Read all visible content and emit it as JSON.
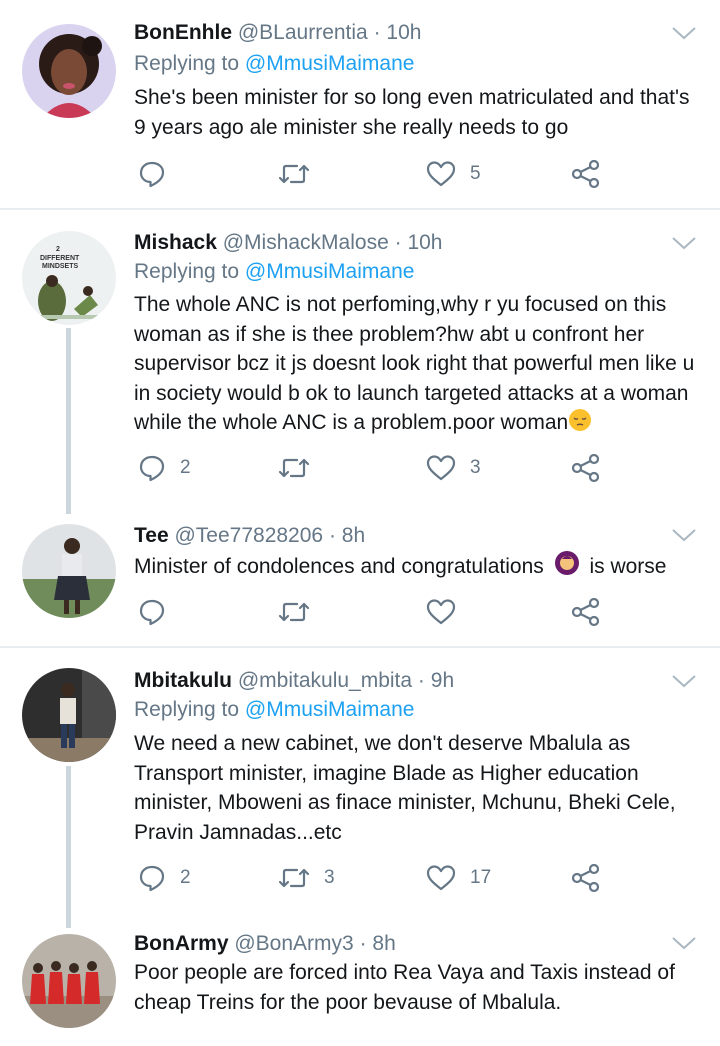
{
  "tweets": [
    {
      "name": "BonEnhle",
      "handle": "@BLaurrentia",
      "time": "10h",
      "replying_prefix": "Replying to",
      "replying_to": "@MmusiMaimane",
      "text": "She's been minister for so long even matriculated and that's 9 years ago ale minister she really needs to go",
      "replies": "",
      "retweets": "",
      "likes": "5"
    },
    {
      "name": "Mishack",
      "handle": "@MishackMalose",
      "time": "10h",
      "replying_prefix": "Replying to",
      "replying_to": "@MmusiMaimane",
      "text": "The whole ANC is not perfoming,why r yu focused on this woman as if she is thee problem?hw abt u confront her supervisor bcz it js doesnt look right that powerful men like u in society would b ok to launch targeted attacks at a woman while the whole ANC is a problem.poor woman",
      "replies": "2",
      "retweets": "",
      "likes": "3",
      "avatar_text_1": "2",
      "avatar_text_2": "DIFFERENT",
      "avatar_text_3": "MINDSETS"
    },
    {
      "name": "Tee",
      "handle": "@Tee77828206",
      "time": "8h",
      "text_before": "Minister of condolences and congratulations",
      "text_after": "is worse",
      "replies": "",
      "retweets": "",
      "likes": ""
    },
    {
      "name": "Mbitakulu",
      "handle": "@mbitakulu_mbita",
      "time": "9h",
      "replying_prefix": "Replying to",
      "replying_to": "@MmusiMaimane",
      "text": "We need a new cabinet, we don't deserve Mbalula as Transport minister, imagine Blade as Higher education minister, Mboweni as finace minister, Mchunu, Bheki Cele, Pravin Jamnadas...etc",
      "replies": "2",
      "retweets": "3",
      "likes": "17"
    },
    {
      "name": "BonArmy",
      "handle": "@BonArmy3",
      "time": "8h",
      "text": "Poor people are forced into Rea Vaya and Taxis instead of cheap Treins for the poor bevause of Mbalula."
    }
  ],
  "separator": "·",
  "icons": {
    "reply": "reply-icon",
    "retweet": "retweet-icon",
    "like": "heart-icon",
    "share": "share-icon",
    "menu": "chevron-down-icon",
    "emoji_pensive": "pensive-face-emoji",
    "emoji_facepalm": "facepalm-emoji"
  },
  "colors": {
    "text": "#14171a",
    "secondary": "#657786",
    "link": "#1da1f2",
    "divider": "#e6ecf0",
    "thread_line": "#ccd6dd"
  }
}
